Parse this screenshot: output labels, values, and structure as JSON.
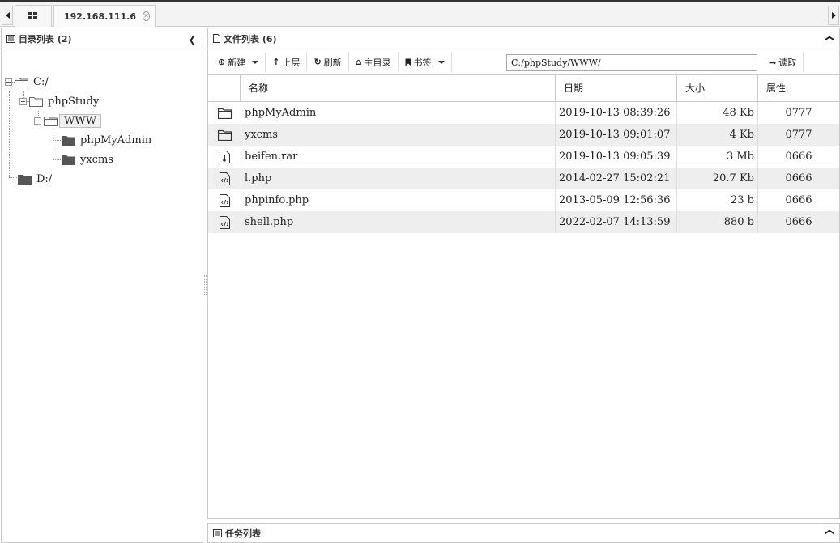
{
  "tabs": {
    "home_icon": "grid-icon",
    "host": {
      "label": "192.168.111.6",
      "icon": "folder-icon"
    }
  },
  "left": {
    "title": "目录列表 (2)",
    "tree": [
      {
        "label": "C:/",
        "level": 0,
        "expanded": true,
        "icon": "folder-open-icon"
      },
      {
        "label": "phpStudy",
        "level": 1,
        "expanded": true,
        "icon": "folder-open-icon"
      },
      {
        "label": "WWW",
        "level": 2,
        "expanded": true,
        "selected": true,
        "icon": "folder-open-icon"
      },
      {
        "label": "phpMyAdmin",
        "level": 3,
        "icon": "folder-icon"
      },
      {
        "label": "yxcms",
        "level": 3,
        "icon": "folder-icon"
      },
      {
        "label": "D:/",
        "level": 0,
        "icon": "folder-icon"
      }
    ]
  },
  "right": {
    "title": "文件列表 (6)",
    "toolbar": {
      "new": "新建",
      "up": "上层",
      "refresh": "刷新",
      "home": "主目录",
      "bookmarks": "书签",
      "path": "C:/phpStudy/WWW/",
      "read": "读取"
    },
    "columns": {
      "name": "名称",
      "date": "日期",
      "size": "大小",
      "attr": "属性"
    },
    "files": [
      {
        "type": "folder",
        "name": "phpMyAdmin",
        "date": "2019-10-13 08:39:26",
        "size": "48 Kb",
        "attr": "0777"
      },
      {
        "type": "folder",
        "name": "yxcms",
        "date": "2019-10-13 09:01:07",
        "size": "4 Kb",
        "attr": "0777"
      },
      {
        "type": "archive",
        "name": "beifen.rar",
        "date": "2019-10-13 09:05:39",
        "size": "3 Mb",
        "attr": "0666"
      },
      {
        "type": "code",
        "name": "l.php",
        "date": "2014-02-27 15:02:21",
        "size": "20.7 Kb",
        "attr": "0666"
      },
      {
        "type": "code",
        "name": "phpinfo.php",
        "date": "2013-05-09 12:56:36",
        "size": "23 b",
        "attr": "0666"
      },
      {
        "type": "code",
        "name": "shell.php",
        "date": "2022-02-07 14:13:59",
        "size": "880 b",
        "attr": "0666"
      }
    ]
  },
  "bottom": {
    "title": "任务列表"
  }
}
